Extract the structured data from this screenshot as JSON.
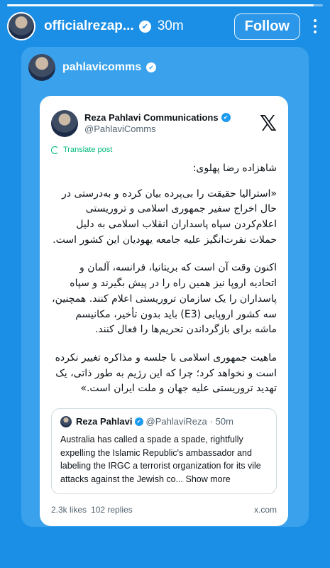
{
  "story": {
    "progress": 0.97,
    "username": "officialrezap...",
    "time": "30m",
    "follow_label": "Follow"
  },
  "shared": {
    "username": "pahlavicomms"
  },
  "tweet": {
    "name": "Reza Pahlavi Communications",
    "handle": "@PahlaviComms",
    "logo": "𝕏",
    "translate_label": "Translate post",
    "paragraphs": [
      "شاهزاده رضا پهلوی:",
      "«استرالیا حقیقت را بی‌پرده بیان کرده و به‌درستی در حال اخراج سفیر جمهوری اسلامی و تروریستی اعلام‌کردن سپاه پاسداران انقلاب اسلامی به دلیل حملات نفرت‌انگیز علیه جامعه یهودیان این کشور است.",
      "اکنون وقت آن است که بریتانیا، فرانسه، آلمان و اتحادیه اروپا نیز همین راه را در پیش بگیرند و سپاه پاسداران را یک سازمان تروریستی اعلام کنند. همچنین، سه کشور اروپایی (E3) باید بدون تأخیر، مکانیسم ماشه برای بازگرداندن تحریم‌ها را فعال کنند.",
      "ماهیت جمهوری اسلامی با جلسه و مذاکره تغییر نکرده است و نخواهد کرد؛ چرا که این رژیم به طور ذاتی، یک تهدید تروریستی علیه جهان و ملت ایران است.»"
    ],
    "quote": {
      "name": "Reza Pahlavi",
      "handle": "@PahlaviReza",
      "time": "· 50m",
      "text": "Australia has called a spade a spade, rightfully expelling the Islamic Republic's ambassador and labeling the IRGC a terrorist organization for its vile attacks against the Jewish co...",
      "show_more": "Show more"
    },
    "likes": "2.3k likes",
    "replies": "102 replies",
    "source": "x.com"
  }
}
